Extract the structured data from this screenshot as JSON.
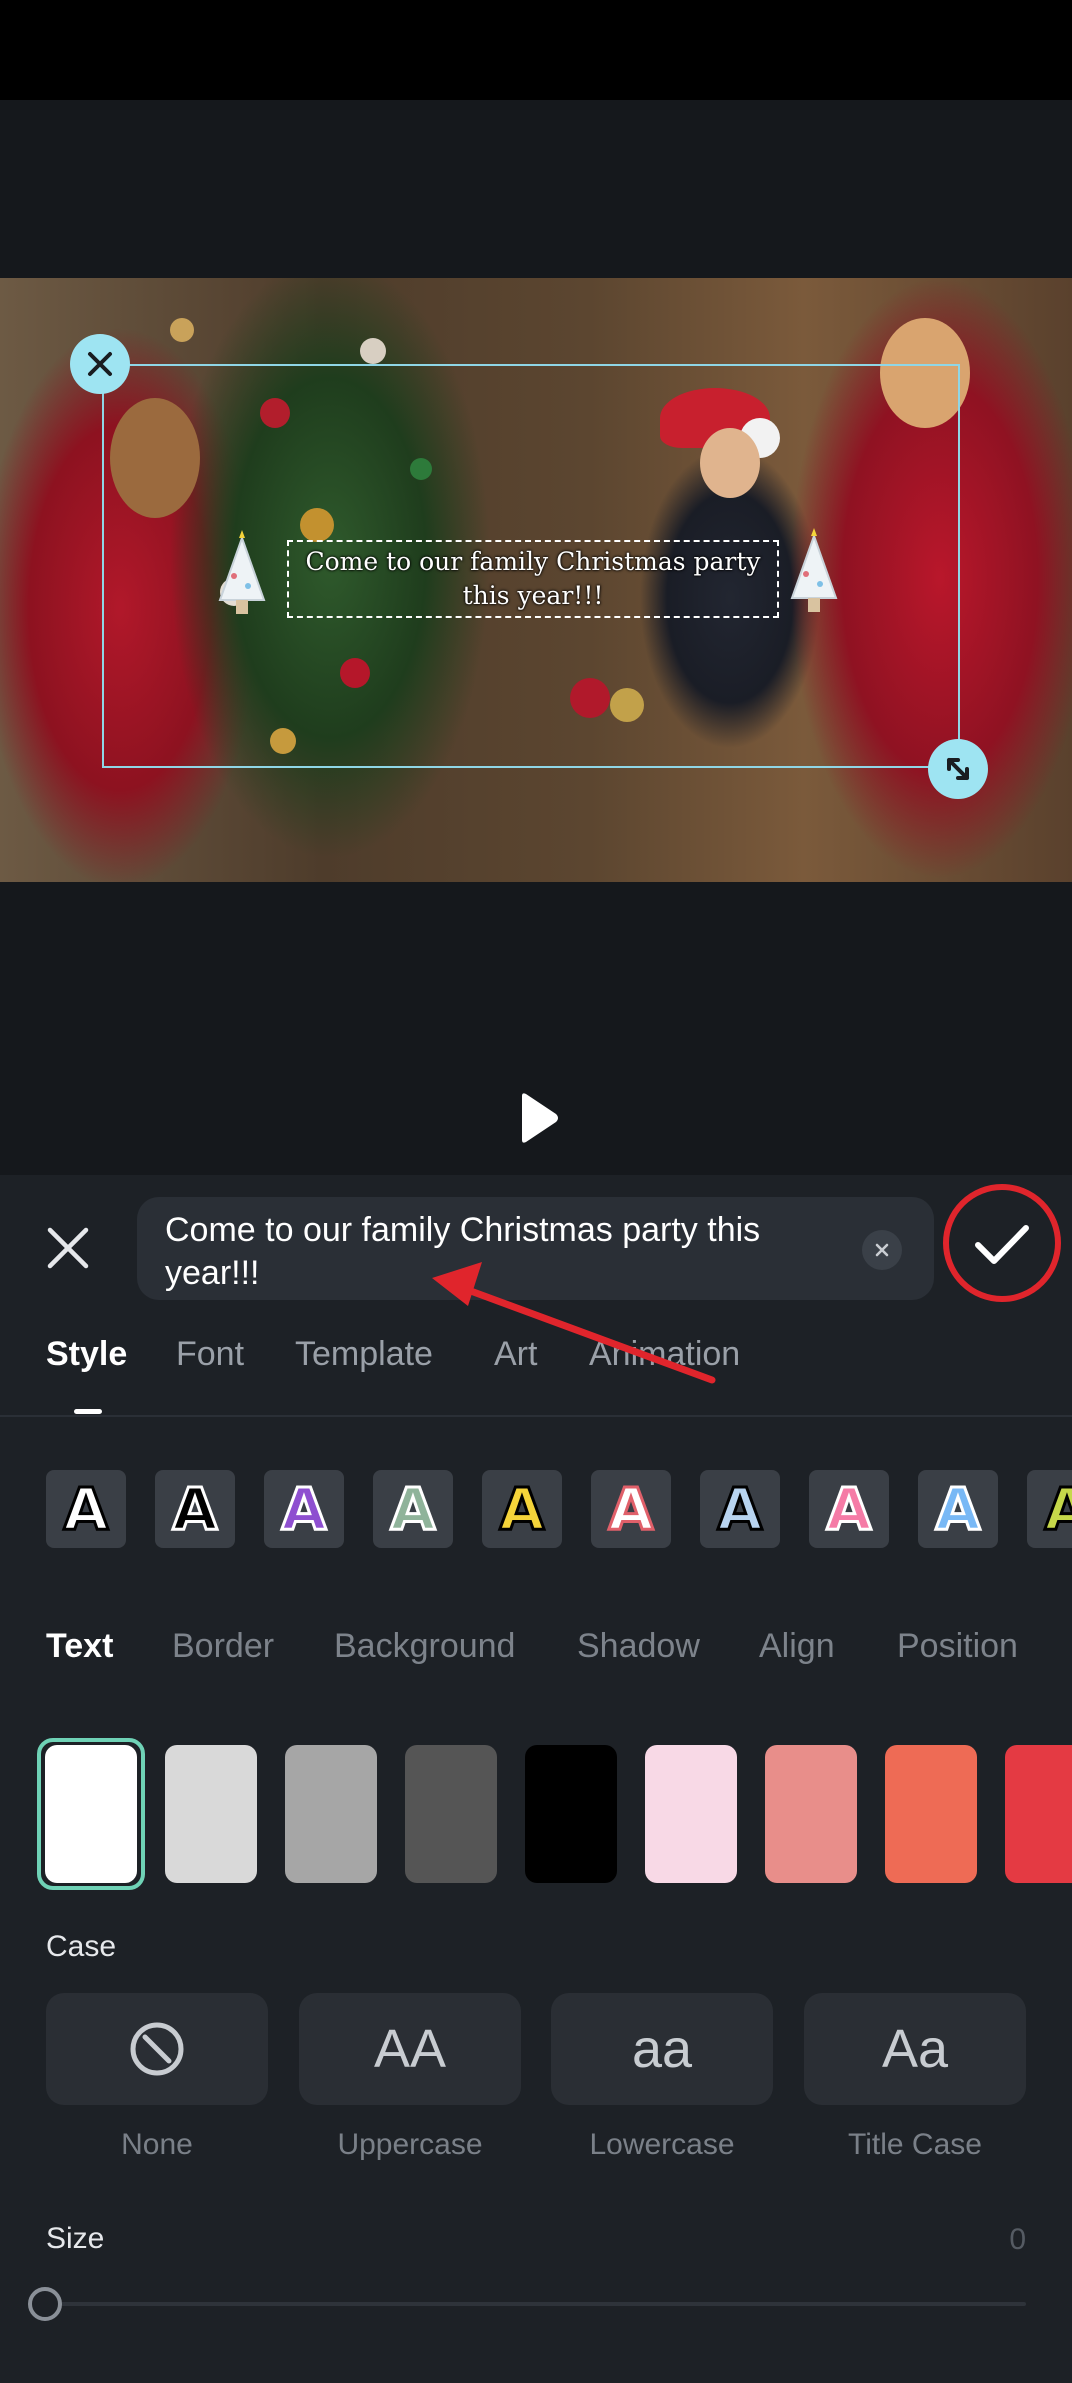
{
  "preview": {
    "overlay_text": "Come to our family Christmas party this year!!!"
  },
  "editor": {
    "input_value": "Come to our family Christmas party this year!!!",
    "tabs": [
      {
        "label": "Style",
        "active": true
      },
      {
        "label": "Font"
      },
      {
        "label": "Template"
      },
      {
        "label": "Art"
      },
      {
        "label": "Animation"
      }
    ],
    "style_presets": [
      {
        "letter": "A",
        "fill": "#ffffff",
        "stroke": "#000000"
      },
      {
        "letter": "A",
        "fill": "#000000",
        "stroke": "#ffffff"
      },
      {
        "letter": "A",
        "fill": "#8e4fd0",
        "stroke": "#ffffff"
      },
      {
        "letter": "A",
        "fill": "#8fb39a",
        "stroke": "#ffffff"
      },
      {
        "letter": "A",
        "fill": "#f5d43a",
        "stroke": "#000000"
      },
      {
        "letter": "A",
        "fill": "#ffffff",
        "stroke": "#e0606a"
      },
      {
        "letter": "A",
        "fill": "#b8d4f0",
        "stroke": "#000000"
      },
      {
        "letter": "A",
        "fill": "#f57ba6",
        "stroke": "#ffffff"
      },
      {
        "letter": "A",
        "fill": "#78b8f5",
        "stroke": "#ffffff"
      },
      {
        "letter": "A",
        "fill": "#c6d84a",
        "stroke": "#000000"
      }
    ],
    "subtabs": [
      {
        "label": "Text",
        "active": true
      },
      {
        "label": "Border"
      },
      {
        "label": "Background"
      },
      {
        "label": "Shadow"
      },
      {
        "label": "Align"
      },
      {
        "label": "Position"
      }
    ],
    "colors": [
      "#ffffff",
      "#d9d9d9",
      "#a6a6a6",
      "#555555",
      "#000000",
      "#f8d9e6",
      "#e88e8a",
      "#ee6b55",
      "#e43a43"
    ],
    "selected_color": "#ffffff",
    "case": {
      "label": "Case",
      "options": [
        {
          "glyph": "",
          "label": "None"
        },
        {
          "glyph": "AA",
          "label": "Uppercase"
        },
        {
          "glyph": "aa",
          "label": "Lowercase"
        },
        {
          "glyph": "Aa",
          "label": "Title Case"
        }
      ]
    },
    "size": {
      "label": "Size",
      "value": "0"
    }
  },
  "colors": {
    "accent_ring": "#e0252c",
    "selection_handle": "#9ee4f2",
    "swatch_selected": "#6fd2b6"
  }
}
